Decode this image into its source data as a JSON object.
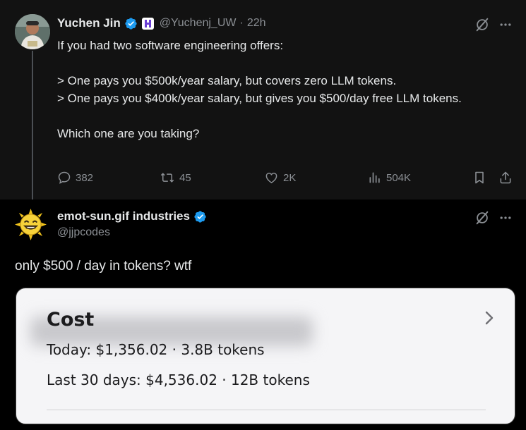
{
  "post1": {
    "name": "Yuchen Jin",
    "handle": "@Yuchenj_UW",
    "separator": "·",
    "time": "22h",
    "lines": [
      "If you had two software engineering offers:",
      "",
      "> One pays you $500k/year salary, but covers zero LLM tokens.",
      "> One pays you $400k/year salary, but gives you $500/day free LLM tokens.",
      "",
      "Which one are you taking?"
    ],
    "stats": {
      "replies": "382",
      "reposts": "45",
      "likes": "2K",
      "views": "504K"
    }
  },
  "post2": {
    "name": "emot-sun.gif industries",
    "handle": "@jjpcodes",
    "text": "only $500 / day in tokens? wtf",
    "card": {
      "title": "Cost",
      "today": "Today: $1,356.02 · 3.8B tokens",
      "last30": "Last 30 days: $4,536.02 · 12B tokens"
    }
  },
  "colors": {
    "verified": "#1d9bf0",
    "muted": "#8b8f94",
    "text": "#e7e9ea",
    "card_bg": "#f5f5f7"
  },
  "icons": [
    "verified-badge-icon",
    "org-badge-icon",
    "grok-icon",
    "more-icon",
    "reply-icon",
    "repost-icon",
    "like-icon",
    "views-icon",
    "bookmark-icon",
    "share-icon",
    "chevron-right-icon"
  ]
}
